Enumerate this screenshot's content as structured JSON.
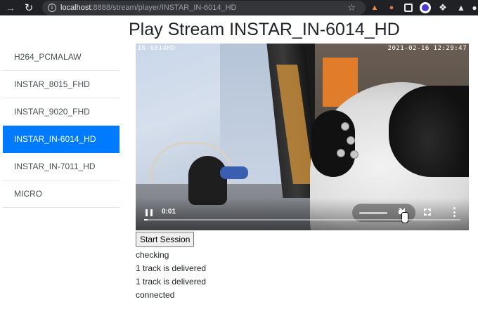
{
  "browser": {
    "url_host": "localhost",
    "url_rest": ":8888/stream/player/INSTAR_IN-6014_HD",
    "extensions": [
      "extension-fox-icon",
      "extension-person-icon",
      "extension-grid-icon",
      "extension-circle-icon",
      "extensions-puzzle-icon",
      "extension-flask-icon",
      "extension-person-icon"
    ]
  },
  "page": {
    "title": "Play Stream INSTAR_IN-6014_HD"
  },
  "sidebar": {
    "items": [
      {
        "label": "H264_PCMALAW",
        "active": false
      },
      {
        "label": "INSTAR_8015_FHD",
        "active": false
      },
      {
        "label": "INSTAR_9020_FHD",
        "active": false
      },
      {
        "label": "INSTAR_IN-6014_HD",
        "active": true
      },
      {
        "label": "INSTAR_IN-7011_HD",
        "active": false
      },
      {
        "label": "MICRO",
        "active": false
      }
    ]
  },
  "video": {
    "osd_name": "IN-6014HD",
    "osd_time": "2021-02-16 12:29:47",
    "current_time": "0:01",
    "progress": 0.01,
    "muted": true
  },
  "session": {
    "button_label": "Start Session",
    "log": [
      "checking",
      "1 track is delivered",
      "1 track is delivered",
      "connected"
    ]
  },
  "colors": {
    "accent": "#007bff",
    "chrome_bg": "#202124"
  }
}
